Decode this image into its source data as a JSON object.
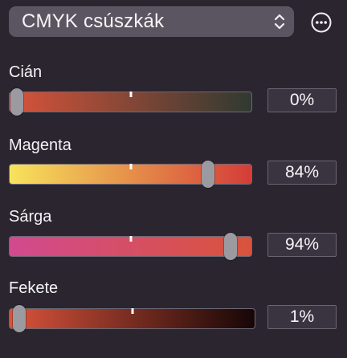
{
  "header": {
    "title": "CMYK csúszkák"
  },
  "sliders": [
    {
      "label": "Cián",
      "value_text": "0%",
      "value": 0,
      "gradient": [
        "#d9533b",
        "#2f3a31"
      ]
    },
    {
      "label": "Magenta",
      "value_text": "84%",
      "value": 84,
      "gradient": [
        "#f7e35c",
        "#d43c38"
      ]
    },
    {
      "label": "Sárga",
      "value_text": "94%",
      "value": 94,
      "gradient": [
        "#d24a8f",
        "#d9533b"
      ]
    },
    {
      "label": "Fekete",
      "value_text": "1%",
      "value": 1,
      "gradient": [
        "#d9533b",
        "#160606"
      ]
    }
  ],
  "icons": {
    "header_updown": "chevron-up-down-icon",
    "more": "ellipsis-circle-icon"
  }
}
